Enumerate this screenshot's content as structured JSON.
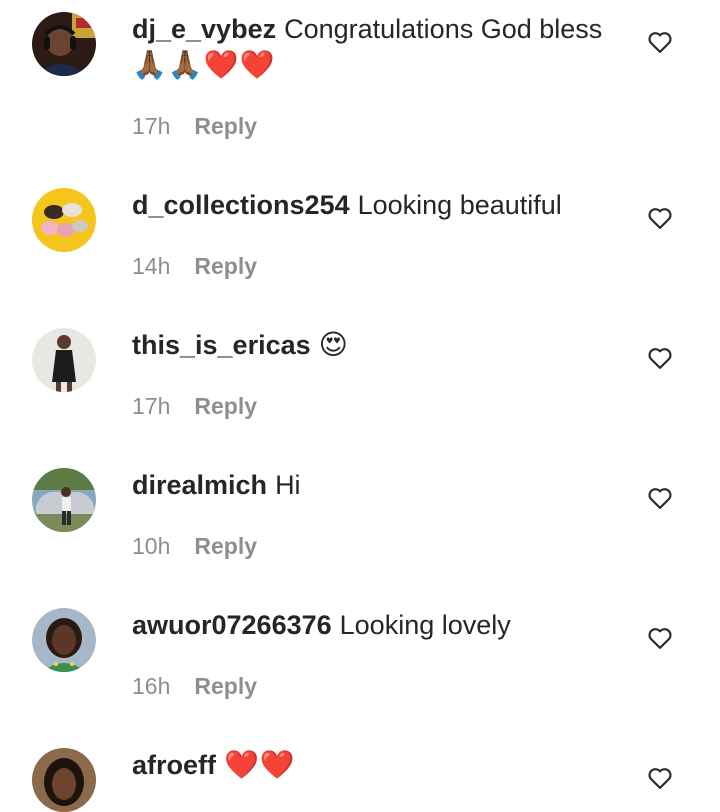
{
  "comments": [
    {
      "username": "dj_e_vybez",
      "text": "Congratulations God bless",
      "emoji": "🙏🏾🙏🏾❤️❤️",
      "time": "17h",
      "reply": "Reply",
      "avatar": "dj-avatar"
    },
    {
      "username": "d_collections254",
      "text": "Looking beautiful",
      "emoji": "",
      "time": "14h",
      "reply": "Reply",
      "avatar": "slippers-avatar"
    },
    {
      "username": "this_is_ericas",
      "text": "",
      "emoji": "😍",
      "time": "17h",
      "reply": "Reply",
      "avatar": "woman-black-dress-avatar"
    },
    {
      "username": "direalmich",
      "text": "Hi",
      "emoji": "",
      "time": "10h",
      "reply": "Reply",
      "avatar": "man-car-avatar"
    },
    {
      "username": "awuor07266376",
      "text": "Looking lovely",
      "emoji": "",
      "time": "16h",
      "reply": "Reply",
      "avatar": "woman-portrait-avatar"
    },
    {
      "username": "afroeff",
      "text": "",
      "emoji": "❤️❤️",
      "time": "",
      "reply": "",
      "avatar": "woman-avatar"
    }
  ],
  "icons": {
    "like": "heart-outline-icon"
  },
  "colors": {
    "text": "#262626",
    "meta": "#8e8e8e",
    "heart": "#262626",
    "emoji_red": "#e0162b"
  }
}
